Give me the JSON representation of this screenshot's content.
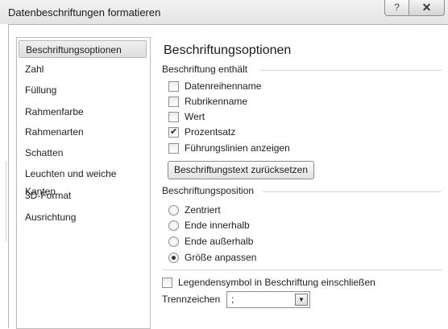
{
  "window": {
    "title": "Datenbeschriftungen formatieren",
    "help_glyph": "?",
    "close_glyph": "✕"
  },
  "nav": {
    "items": [
      {
        "label": "Beschriftungsoptionen",
        "selected": true
      },
      {
        "label": "Zahl"
      },
      {
        "label": "Füllung"
      },
      {
        "label": "Rahmenfarbe"
      },
      {
        "label": "Rahmenarten"
      },
      {
        "label": "Schatten"
      },
      {
        "label": "Leuchten und weiche Kanten"
      },
      {
        "label": "3D-Format"
      },
      {
        "label": "Ausrichtung"
      }
    ]
  },
  "main": {
    "heading": "Beschriftungsoptionen",
    "contains_group": {
      "label": "Beschriftung enthält",
      "options": [
        {
          "label": "Datenreihenname",
          "checked": false
        },
        {
          "label": "Rubrikenname",
          "checked": false
        },
        {
          "label": "Wert",
          "checked": false
        },
        {
          "label": "Prozentsatz",
          "checked": true
        },
        {
          "label": "Führungslinien anzeigen",
          "checked": false
        }
      ],
      "reset_button": "Beschriftungstext zurücksetzen"
    },
    "position_group": {
      "label": "Beschriftungsposition",
      "options": [
        {
          "label": "Zentriert",
          "selected": false
        },
        {
          "label": "Ende innerhalb",
          "selected": false
        },
        {
          "label": "Ende außerhalb",
          "selected": false
        },
        {
          "label": "Größe anpassen",
          "selected": true
        }
      ]
    },
    "legend_key": {
      "label": "Legendensymbol in Beschriftung einschließen",
      "checked": false
    },
    "separator": {
      "label": "Trennzeichen",
      "value": ";",
      "arrow_glyph": "▼"
    },
    "check_glyph": "✔"
  }
}
